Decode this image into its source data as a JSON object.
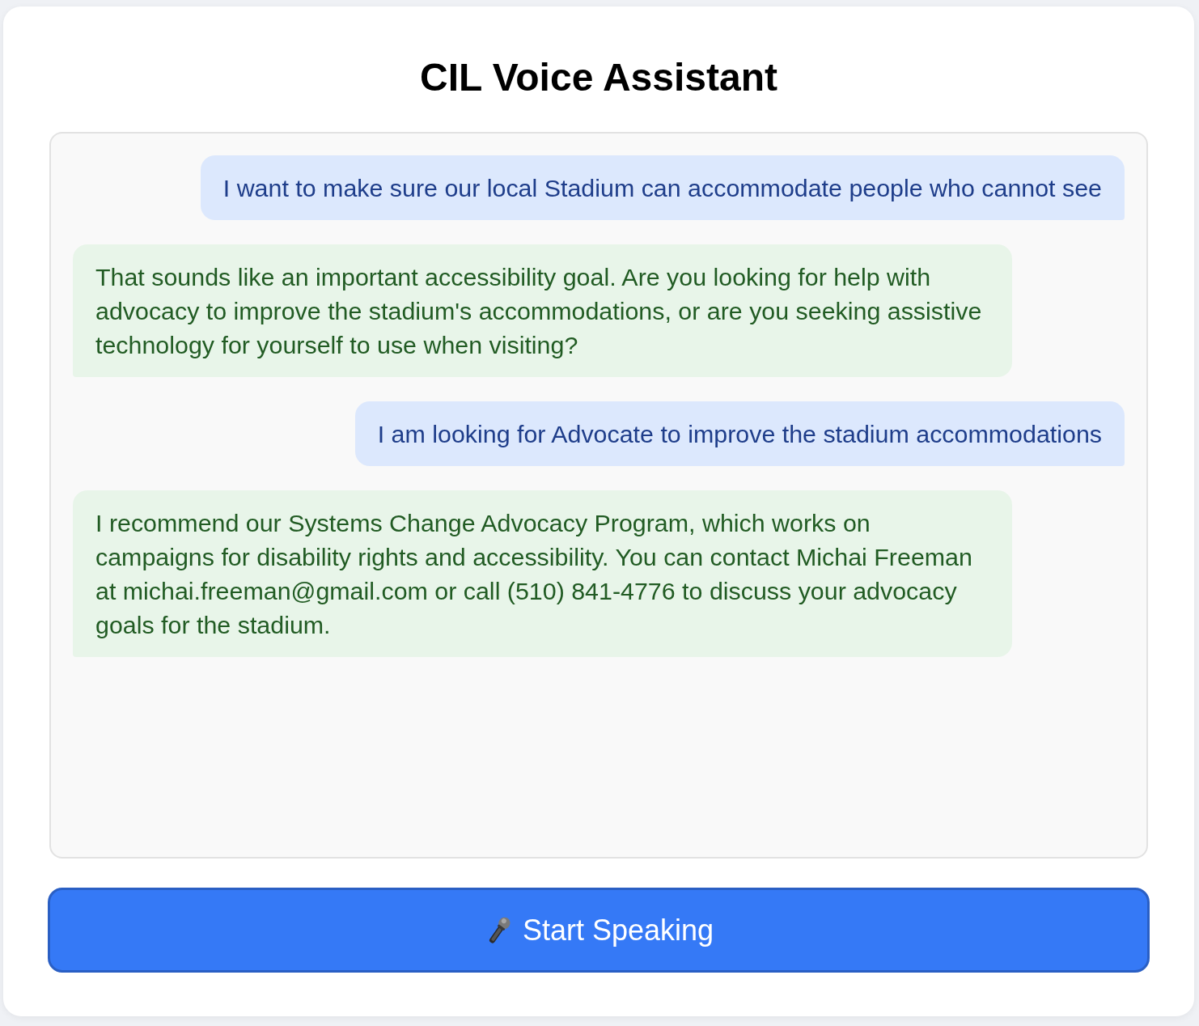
{
  "title": "CIL Voice Assistant",
  "messages": [
    {
      "kind": "user",
      "text": "I want to make sure our local Stadium can accommodate people who cannot see"
    },
    {
      "kind": "assistant",
      "text": "That sounds like an important accessibility goal. Are you looking for help with advocacy to improve the stadium's accommodations, or are you seeking assistive technology for yourself to use when visiting?"
    },
    {
      "kind": "user",
      "text": "I am looking for Advocate to improve the stadium accommodations"
    },
    {
      "kind": "assistant",
      "text": "I recommend our Systems Change Advocacy Program, which works on campaigns for disability rights and accessibility. You can contact Michai Freeman at michai.freeman@gmail.com or call (510) 841-4776 to discuss your advocacy goals for the stadium."
    }
  ],
  "button": {
    "label": "Start Speaking"
  }
}
